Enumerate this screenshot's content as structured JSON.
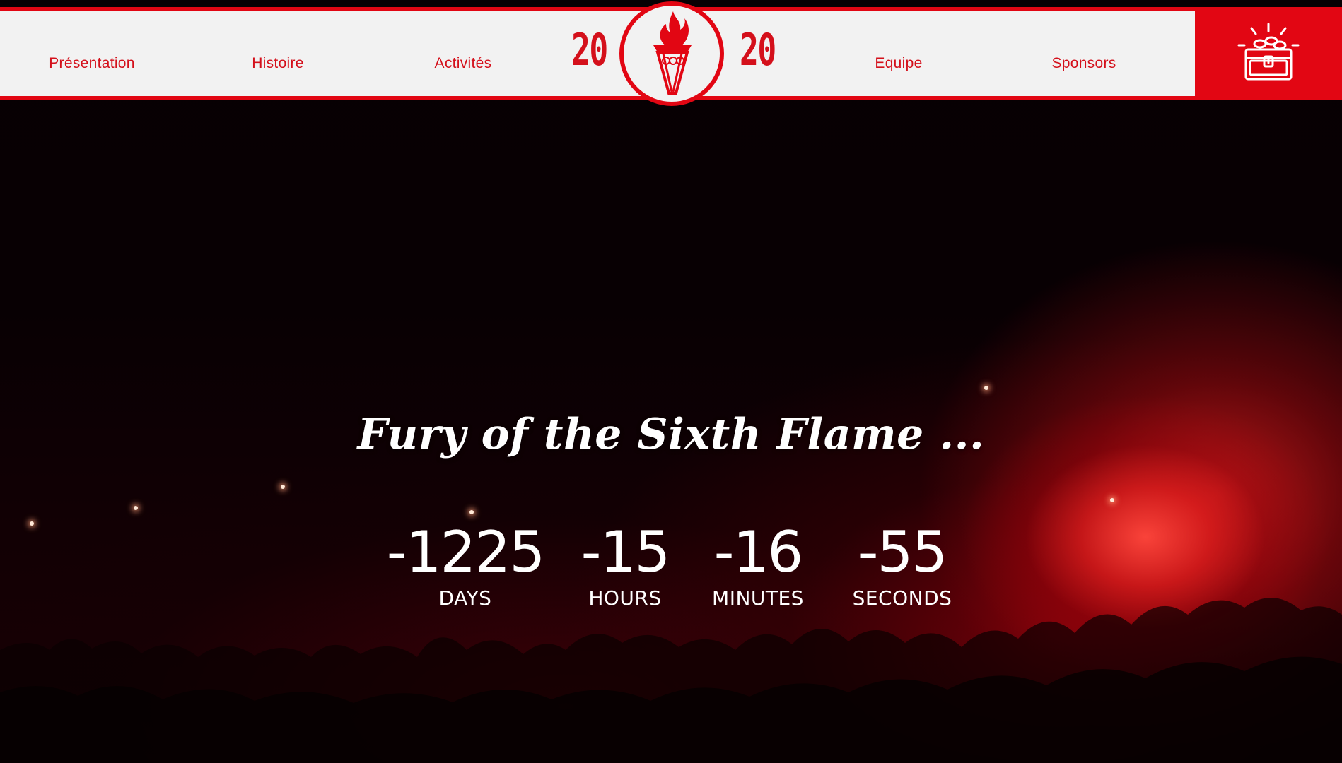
{
  "nav": {
    "left_items": [
      {
        "label": "Présentation"
      },
      {
        "label": "Histoire"
      },
      {
        "label": "Activités"
      }
    ],
    "right_items": [
      {
        "label": "Equipe"
      },
      {
        "label": "Sponsors"
      }
    ],
    "logo": {
      "year_left": "20",
      "year_right": "20",
      "icon": "torch-flame-logo-icon"
    },
    "cart_icon": "treasure-chest-icon"
  },
  "hero": {
    "tagline": "Fury of the Sixth Flame ...",
    "countdown": [
      {
        "value": "-1225",
        "label": "DAYS"
      },
      {
        "value": "-15",
        "label": "HOURS"
      },
      {
        "value": "-16",
        "label": "MINUTES"
      },
      {
        "value": "-55",
        "label": "SECONDS"
      }
    ]
  },
  "colors": {
    "brand_red": "#e20613",
    "nav_text": "#d4101b",
    "nav_background": "#f2f2f2",
    "hero_text": "#ffffff"
  }
}
